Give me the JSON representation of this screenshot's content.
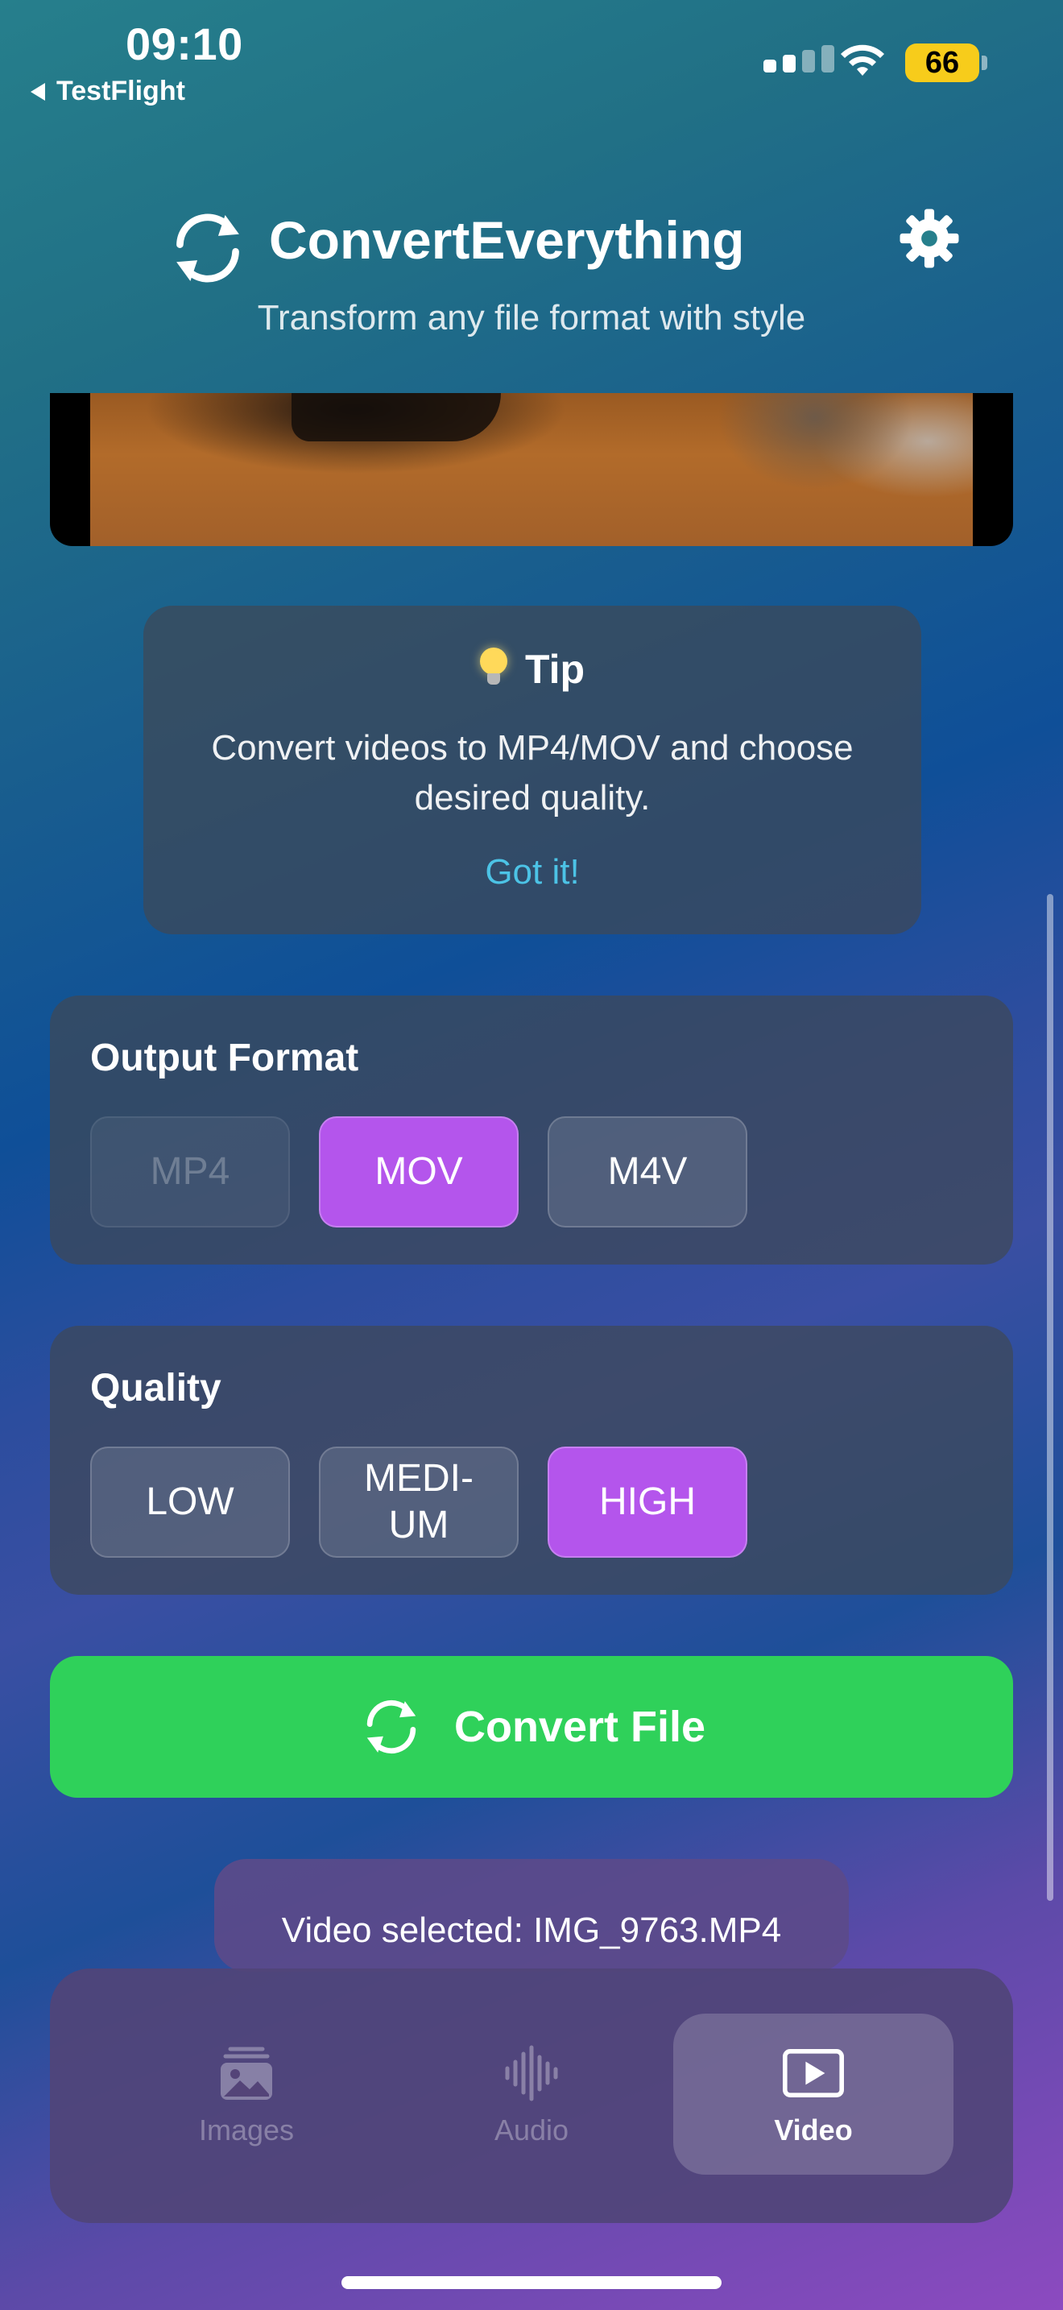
{
  "status_bar": {
    "time": "09:10",
    "back_app": "TestFlight",
    "battery": "66"
  },
  "header": {
    "app_title": "ConvertEverything",
    "subtitle": "Transform any file format with style"
  },
  "tip": {
    "heading": "Tip",
    "text": "Convert videos to MP4/MOV and choose desired quality.",
    "dismiss_label": "Got it!"
  },
  "output_format": {
    "title": "Output Format",
    "options": [
      "MP4",
      "MOV",
      "M4V"
    ],
    "selected": "MOV",
    "disabled": "MP4"
  },
  "quality": {
    "title": "Quality",
    "options": [
      "LOW",
      "MEDI-\nUM",
      "HIGH"
    ],
    "selected": "HIGH"
  },
  "convert_button": {
    "label": "Convert File"
  },
  "toast": {
    "text": "Video selected: IMG_9763.MP4"
  },
  "tab_bar": {
    "tabs": [
      {
        "label": "Images",
        "icon": "photo-stack-icon"
      },
      {
        "label": "Audio",
        "icon": "waveform-icon"
      },
      {
        "label": "Video",
        "icon": "play-rectangle-icon"
      }
    ],
    "active": "Video"
  },
  "colors": {
    "accent_selected": "#b455ec",
    "convert_green": "#2fd15a",
    "tip_link": "#4cc3e6",
    "battery_yellow": "#f7cc1b"
  }
}
